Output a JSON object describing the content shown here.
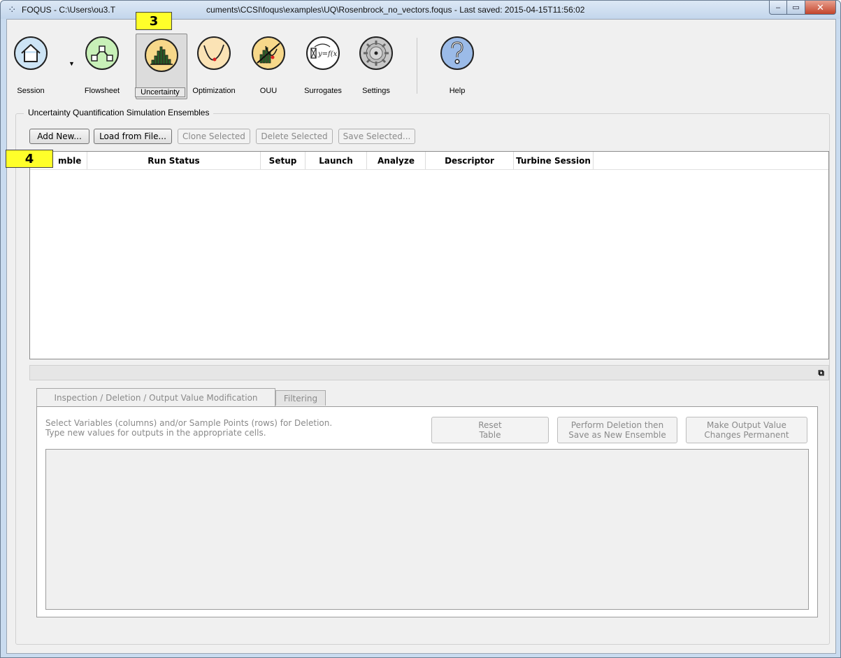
{
  "window": {
    "title": "FOQUS - C:\\Users\\ou3.T                        cuments\\CCSI\\foqus\\examples\\UQ\\Rosenbrock_no_vectors.foqus - Last saved: 2015-04-15T11:56:02",
    "title_left": "FOQUS - C:\\Users\\ou3.T",
    "title_right": "cuments\\CCSI\\foqus\\examples\\UQ\\Rosenbrock_no_vectors.foqus - Last saved: 2015-04-15T11:56:02",
    "minimize_glyph": "–",
    "maximize_glyph": "▭",
    "close_glyph": "✕"
  },
  "toolbar": {
    "items": [
      {
        "label": "Session",
        "icon": "home-icon",
        "color": "#cde4f5"
      },
      {
        "label": "Flowsheet",
        "icon": "flowsheet-icon",
        "color": "#c8f0b8"
      },
      {
        "label": "Uncertainty",
        "icon": "histogram-icon",
        "color": "#f7d88a",
        "active": true
      },
      {
        "label": "Optimization",
        "icon": "optimization-curve-icon",
        "color": "#fbe3b5"
      },
      {
        "label": "OUU",
        "icon": "ouu-icon",
        "color": "#f7d88a"
      },
      {
        "label": "Surrogates",
        "icon": "surrogate-function-icon",
        "color": "#ffffff"
      },
      {
        "label": "Settings",
        "icon": "gear-icon",
        "color": "#c8c8c8"
      },
      {
        "label": "Help",
        "icon": "help-icon",
        "color": "#9bbbe8"
      }
    ]
  },
  "callouts": {
    "three": "3",
    "four": "4"
  },
  "ensembles": {
    "group_title": "Uncertainty Quantification Simulation Ensembles",
    "buttons": {
      "add_new": "Add New...",
      "load_from_file": "Load from File...",
      "clone_selected": "Clone Selected",
      "delete_selected": "Delete Selected",
      "save_selected": "Save Selected..."
    },
    "columns": [
      "mble",
      "Run Status",
      "Setup",
      "Launch",
      "Analyze",
      "Descriptor",
      "Turbine Session"
    ]
  },
  "lower_panel": {
    "float_glyph": "⧉",
    "tabs": [
      "Inspection / Deletion / Output Value Modification",
      "Filtering"
    ],
    "instructions_line1": "Select Variables (columns) and/or Sample Points (rows) for Deletion.",
    "instructions_line2": "Type new values for outputs in the appropriate cells.",
    "reset_line1": "Reset",
    "reset_line2": "Table",
    "perform_line1": "Perform Deletion then",
    "perform_line2": "Save as New Ensemble",
    "make_line1": "Make Output Value",
    "make_line2": "Changes Permanent"
  }
}
